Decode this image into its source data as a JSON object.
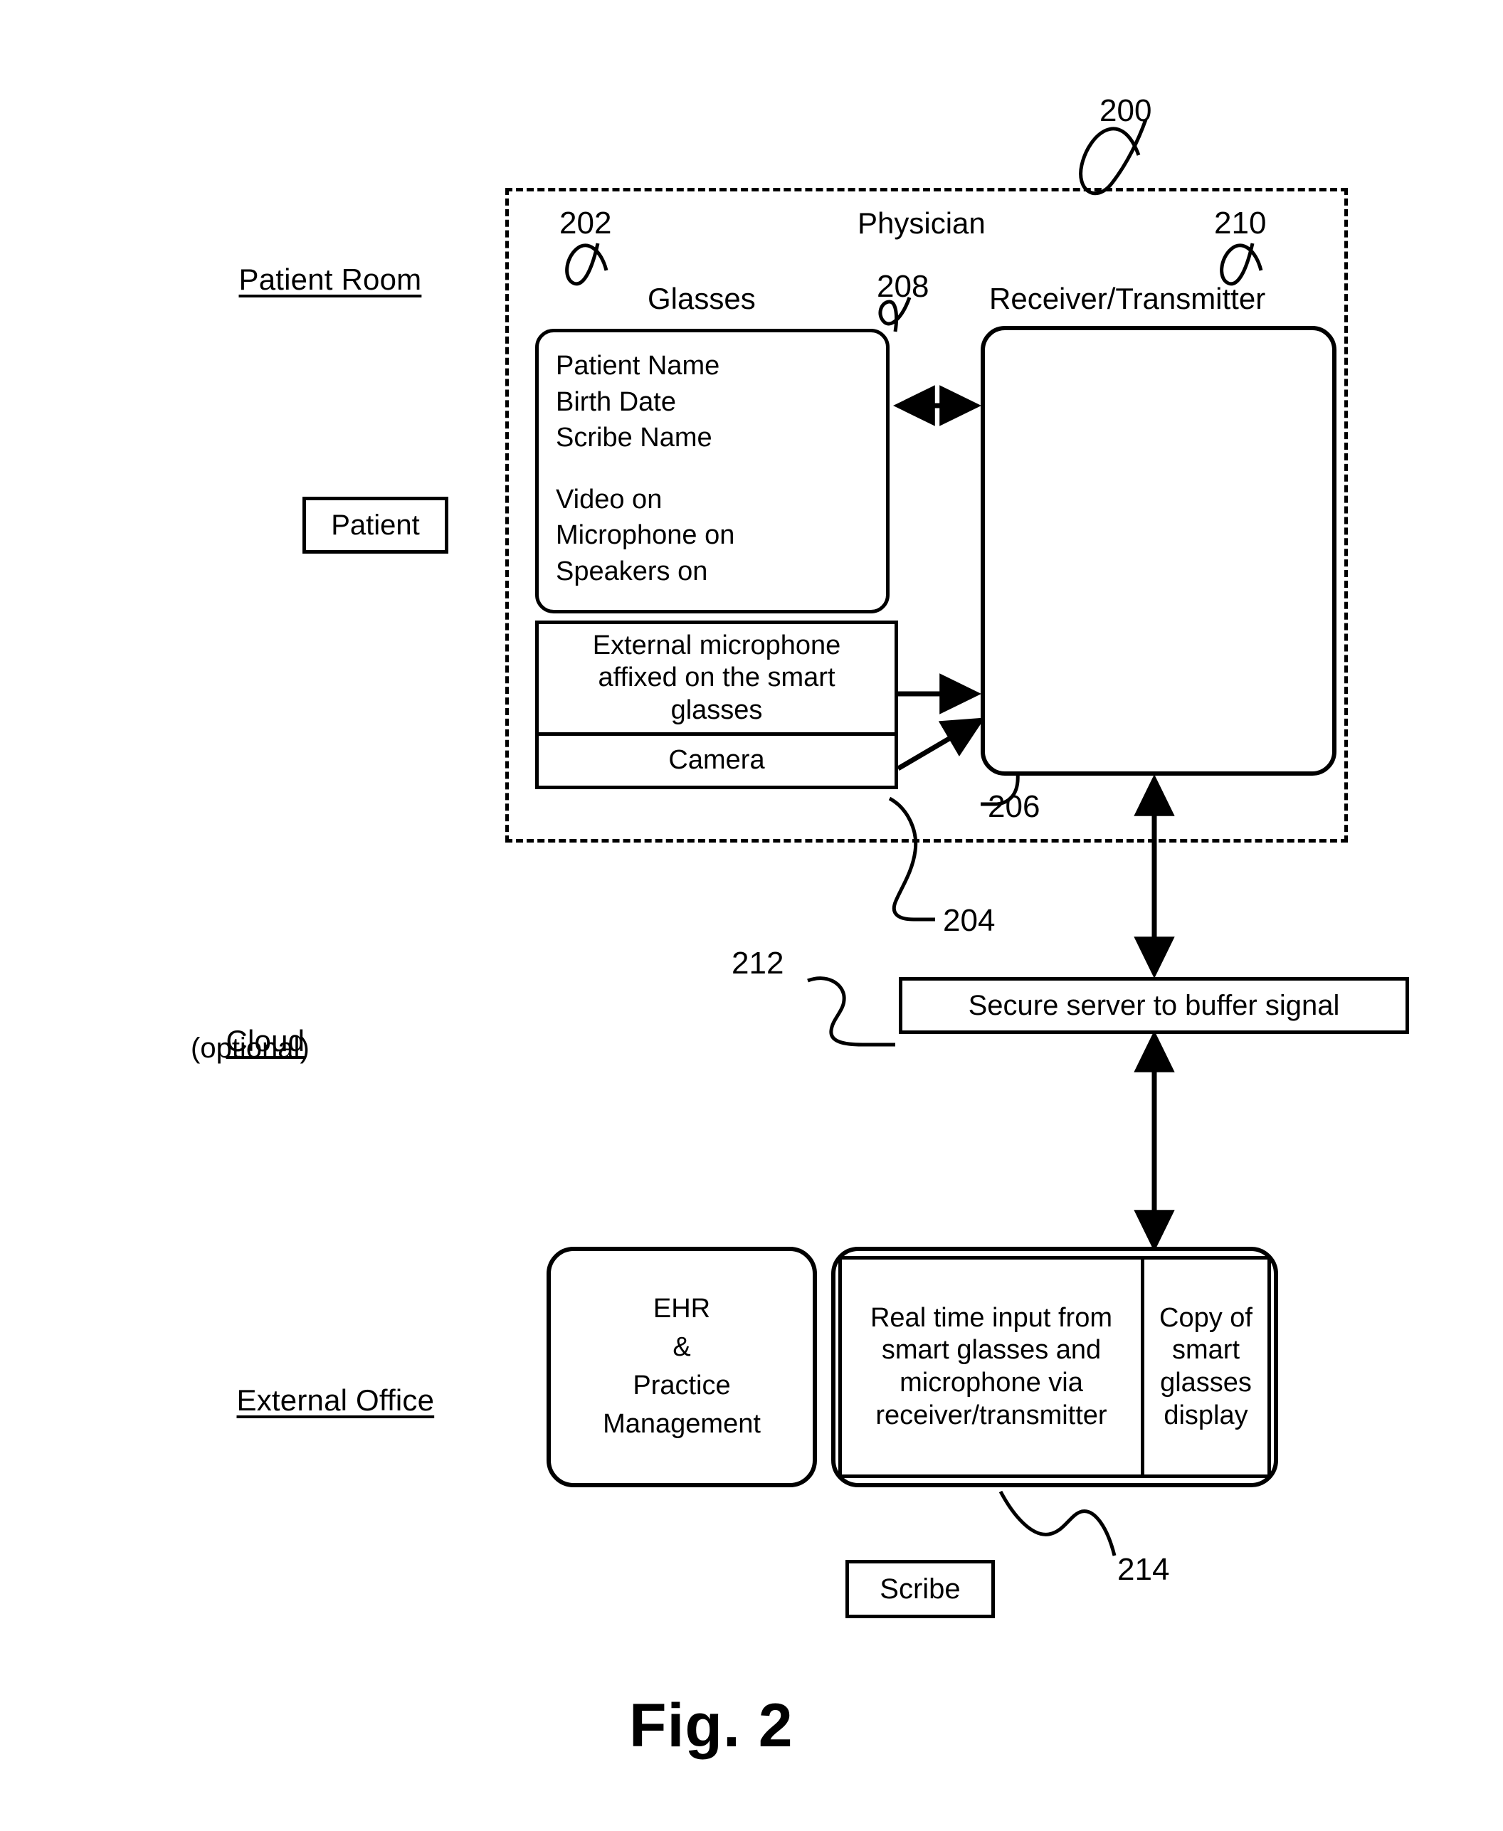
{
  "figure": {
    "caption": "Fig. 2",
    "system_ref": "200"
  },
  "section_labels": {
    "patient_room": "Patient Room",
    "cloud": "Cloud",
    "cloud_sub": "(optional)",
    "external_office": "External Office"
  },
  "actors": {
    "physician": "Physician",
    "patient": "Patient",
    "scribe": "Scribe"
  },
  "patient_room": {
    "glasses": {
      "ref": "202",
      "title": "Glasses",
      "display_ref": "208",
      "display_lines": [
        "Patient Name",
        "Birth Date",
        "Scribe Name",
        "",
        "Video on",
        "Microphone on",
        "Speakers on"
      ],
      "microphone_ref": "206",
      "microphone_text": "External microphone affixed on the smart glasses",
      "camera_ref": "204",
      "camera_text": "Camera"
    },
    "receiver_transmitter": {
      "ref": "210",
      "title": "Receiver/Transmitter"
    }
  },
  "cloud": {
    "server": {
      "ref": "212",
      "text": "Secure server to buffer signal"
    }
  },
  "external_office": {
    "ehr": {
      "lines": [
        "EHR",
        "&",
        "Practice",
        "Management"
      ]
    },
    "workstation": {
      "ref": "214",
      "input_panel": "Real time input from smart glasses and microphone via receiver/transmitter",
      "display_panel": "Copy of smart glasses display"
    }
  }
}
